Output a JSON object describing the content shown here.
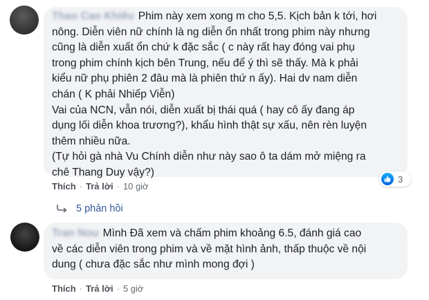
{
  "comments": [
    {
      "author": "Thao Cao Khiêu",
      "lines": [
        "Phim này xem xong m cho 5,5. Kịch bản k tới, hơi",
        "nông. Diễn viên nữ chính là ng diễn ổn nhất trong phim này nhưng",
        "cũng là diễn xuất ổn chứ k đặc sắc ( c này rất hay đóng vai phụ",
        "trong phim chính kịch bên Trung, nếu để ý thì sẽ thấy. Mà k phải",
        "kiểu nữ phụ phiên 2 đâu mà là phiên thứ n ấy). Hai dv nam diễn",
        "chán ( K phải Nhiếp Viễn)",
        "Vai của NCN, vẫn nói, diễn xuất bị thái quá ( hay cô ấy đang áp",
        "dụng lối diễn khoa trương?), khẩu hình thật sự xấu, nên rèn luyện",
        "thêm nhiều nữa.",
        "(Tự hỏi gà nhà Vu Chính diễn như này sao ô ta dám mở miệng ra",
        "chê Thang Duy vậy?)"
      ],
      "actions": {
        "like": "Thích",
        "reply": "Trả lời",
        "time": "10 giờ"
      },
      "reaction_count": "3",
      "reaction_icon": "like-icon",
      "replies_label": "5 phản hồi"
    },
    {
      "author": "Tran Nou",
      "lines": [
        "Mình Đã xem và chấm phim khoảng 6.5, đánh giá cao",
        "về các diễn viên trong phim và về mặt hình ảnh, thấp thuộc về nội",
        "dung ( chưa đặc sắc như mình mong đợi )"
      ],
      "actions": {
        "like": "Thích",
        "reply": "Trả lời",
        "time": "5 giờ"
      }
    }
  ],
  "colors": {
    "bubble": "#f2f3f5",
    "link": "#385898",
    "like_blue": "#1877f2"
  }
}
